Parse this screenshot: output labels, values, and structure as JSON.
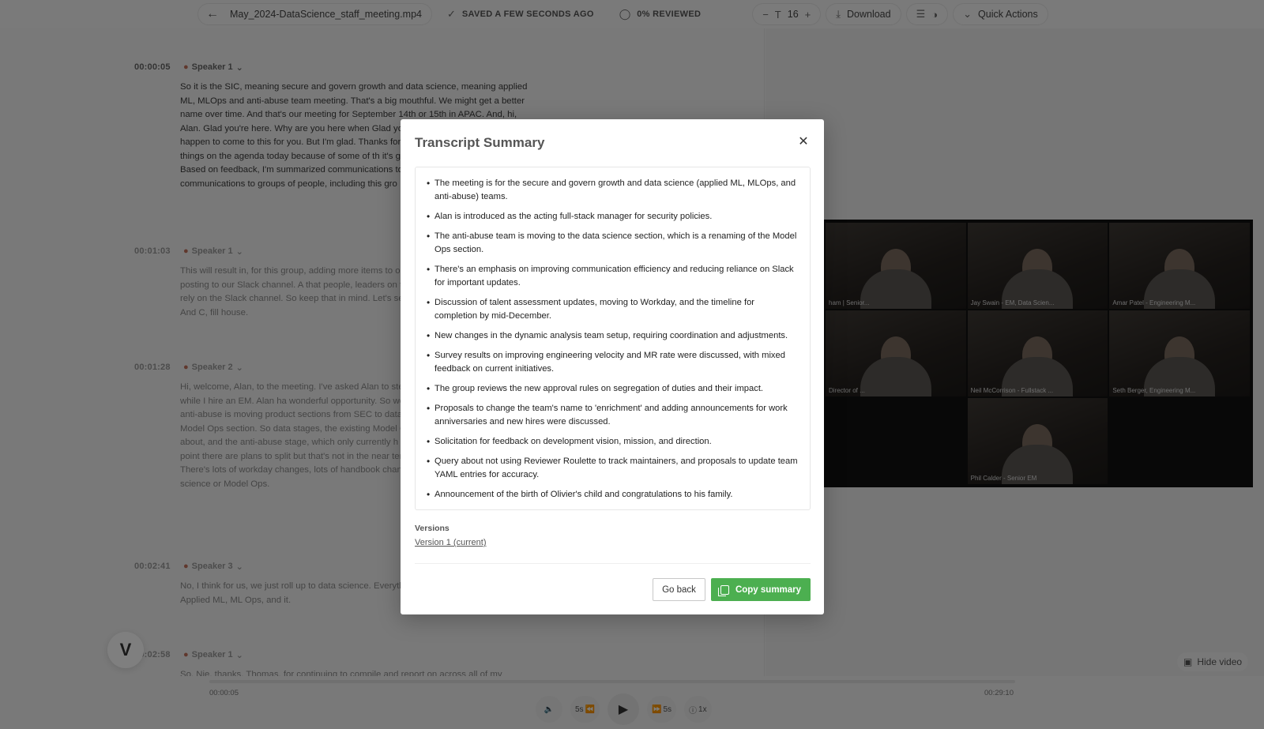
{
  "toolbar": {
    "file_name": "May_2024-DataScience_staff_meeting.mp4",
    "saved_status": "SAVED A FEW SECONDS AGO",
    "reviewed_status": "0% REVIEWED",
    "font_size": "16",
    "download_label": "Download",
    "quick_actions_label": "Quick Actions"
  },
  "transcript": {
    "segments": [
      {
        "timestamp": "00:00:05",
        "speaker": "Speaker 1",
        "text": "So it is the SIC, meaning secure and govern growth and data science, meaning applied ML, MLOps and anti-abuse team meeting. That's a big mouthful. We might get a better name over time. And that's our meeting for September 14th or 15th in APAC. And, hi, Alan. Glad you're here. Why are you here when Glad you're here. Don't make it happen to come to this for you. But I'm glad. Thanks for coming at least once. S lot of things on the agenda today because of some of th it's going to go down over time. Based on feedback, I'm summarized communications to improve the signal to n communications to groups of people, including this gro"
      },
      {
        "timestamp": "00:01:03",
        "speaker": "Speaker 1",
        "text": "This will result in, for this group, adding more items to o as read-only, rather than posting to our Slack channel. A that people, leaders on the team, will attend this meetin rely on the Slack channel. So keep that in mind. Let's se anybody wants to discuss it. And C, fill house."
      },
      {
        "timestamp": "00:01:28",
        "speaker": "Speaker 2",
        "text": "Hi, welcome, Alan, to the meeting. I've asked Alan to ste manager for security policies while I hire an EM. Alan ha wonderful opportunity. So welcome, Alan. Thank you. I'v anti-abuse is moving product sections from SEC to data effectively a rename of the Model Ops section. So data stages, the existing Model Ops, which has three groups about, and the anti-abuse stage, which only currently h anti-abuse. I think at some point there are plans to split but that's not in the near term. And we're working throu There's lots of workday changes, lots of handbook chan anything more about data science or Model Ops."
      },
      {
        "timestamp": "00:02:41",
        "speaker": "Speaker 3",
        "text": "No, I think for us, we just roll up to data science. Everyth still have the two main groups, Applied ML, ML Ops, and it."
      },
      {
        "timestamp": "00:02:58",
        "speaker": "Speaker 1",
        "text": "So, Nie, thanks, Thomas, for continuing to compile and report on across all of my"
      }
    ]
  },
  "video": {
    "participants": [
      {
        "name": "ham | Senior..."
      },
      {
        "name": "Jay Swain - EM, Data Scien..."
      },
      {
        "name": "Amar Patel - Engineering M..."
      },
      {
        "name": "Director of ..."
      },
      {
        "name": "Neil McCorrison - Fullstack ..."
      },
      {
        "name": "Seth Berger, Engineering M..."
      },
      {
        "name": ""
      },
      {
        "name": "Phil Calder - Senior EM"
      },
      {
        "name": ""
      }
    ],
    "hide_video_label": "Hide video"
  },
  "player": {
    "current_time": "00:00:05",
    "total_time": "00:29:10",
    "back_label": "5s",
    "forward_label": "5s",
    "speed_label": "1x"
  },
  "modal": {
    "title": "Transcript Summary",
    "bullets": [
      "The meeting is for the secure and govern growth and data science (applied ML, MLOps, and anti-abuse) teams.",
      "Alan is introduced as the acting full-stack manager for security policies.",
      "The anti-abuse team is moving to the data science section, which is a renaming of the Model Ops section.",
      "There's an emphasis on improving communication efficiency and reducing reliance on Slack for important updates.",
      "Discussion of talent assessment updates, moving to Workday, and the timeline for completion by mid-December.",
      "New changes in the dynamic analysis team setup, requiring coordination and adjustments.",
      "Survey results on improving engineering velocity and MR rate were discussed, with mixed feedback on current initiatives.",
      "The group reviews the new approval rules on segregation of duties and their impact.",
      "Proposals to change the team's name to 'enrichment' and adding announcements for work anniversaries and new hires were discussed.",
      "Solicitation for feedback on development vision, mission, and direction.",
      "Query about not using Reviewer Roulette to track maintainers, and proposals to update team YAML entries for accuracy.",
      "Announcement of the birth of Olivier's child and congratulations to his family."
    ],
    "versions_label": "Versions",
    "version_link": "Version 1 (current)",
    "go_back_label": "Go back",
    "copy_label": "Copy summary"
  },
  "colors": {
    "accent_green": "#4caf50",
    "overlay": "rgba(0,0,0,0.5)"
  }
}
